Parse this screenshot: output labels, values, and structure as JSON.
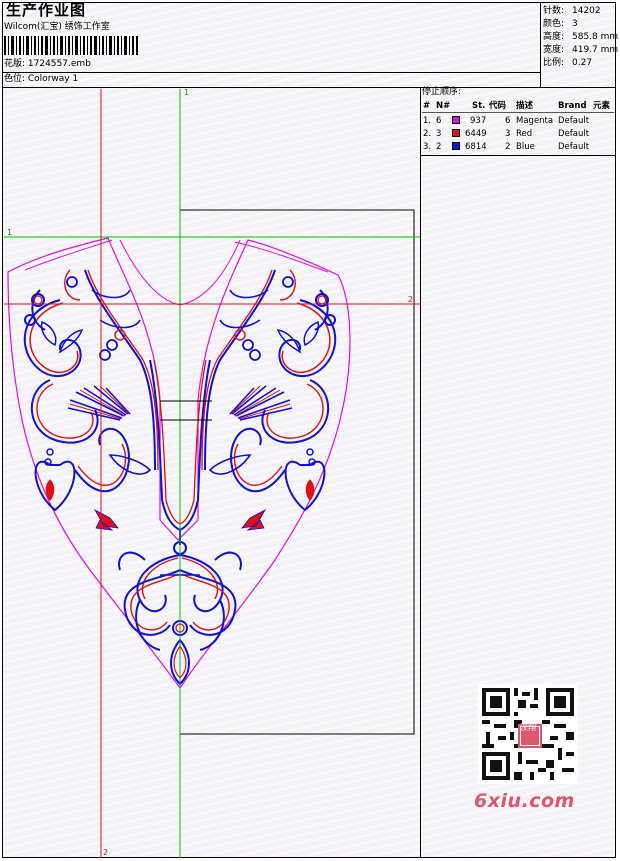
{
  "header": {
    "title": "生产作业图",
    "company": "Wilcom(汇宝) 绣饰工作室",
    "design_label": "花版: 1724557.emb",
    "colorway_label": "色位: Colorway 1"
  },
  "stats": [
    {
      "label": "针数:",
      "value": "14202"
    },
    {
      "label": "颜色:",
      "value": "3"
    },
    {
      "label": "高度:",
      "value": "585.8 mm"
    },
    {
      "label": "宽度:",
      "value": "419.7 mm"
    },
    {
      "label": "比例:",
      "value": "0.27"
    }
  ],
  "stop_sequence": {
    "title": "停止顺序:",
    "columns": [
      "#",
      "N#",
      "St.",
      "代码",
      "描述",
      "Brand",
      "元素"
    ],
    "rows": [
      {
        "num": "1.",
        "n": "6",
        "color": "#e010e0",
        "st": "937",
        "code": "6",
        "desc": "Magenta",
        "brand": "Default"
      },
      {
        "num": "2.",
        "n": "3",
        "color": "#e01010",
        "st": "6449",
        "code": "3",
        "desc": "Red",
        "brand": "Default"
      },
      {
        "num": "3.",
        "n": "2",
        "color": "#1010e0",
        "st": "6814",
        "code": "2",
        "desc": "Blue",
        "brand": "Default"
      }
    ]
  },
  "axis_labels": {
    "v_green_top": "1",
    "h_green_left": "1",
    "h_red_right": "2",
    "v_red_bottom": "2"
  },
  "watermark": "6xiu.com",
  "qr_center_text": "汉翔",
  "colors": {
    "guide_green": "#00c000",
    "guide_red": "#e01010",
    "outline_magenta": "#e010e0",
    "embroidery_blue": "#1010e0"
  }
}
